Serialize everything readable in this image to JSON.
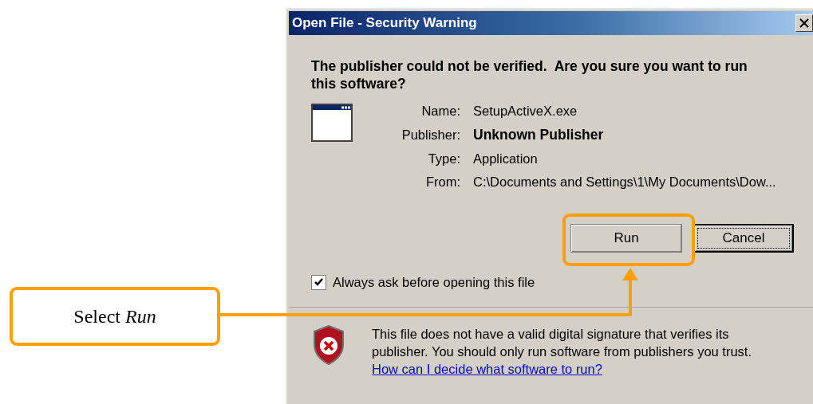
{
  "window": {
    "title": "Open File - Security Warning"
  },
  "heading": "The publisher could not be verified.  Are you sure you want to run this software?",
  "fields": [
    {
      "label": "Name:",
      "value": "SetupActiveX.exe",
      "emphasis": false
    },
    {
      "label": "Publisher:",
      "value": "Unknown Publisher",
      "emphasis": true
    },
    {
      "label": "Type:",
      "value": "Application",
      "emphasis": false
    },
    {
      "label": "From:",
      "value": "C:\\Documents and Settings\\1\\My Documents\\Dow...",
      "emphasis": false
    }
  ],
  "buttons": [
    {
      "label": "Run",
      "highlighted": true,
      "focused": false
    },
    {
      "label": "Cancel",
      "highlighted": false,
      "focused": true
    }
  ],
  "checkbox": {
    "label": "Always ask before opening this file",
    "checked": true
  },
  "warning": {
    "text": "This file does not have a valid digital signature that verifies its publisher.  You should only run software from publishers you trust.",
    "link": "How can I decide what software to run?"
  },
  "callout": {
    "text": "Select *Run*"
  }
}
